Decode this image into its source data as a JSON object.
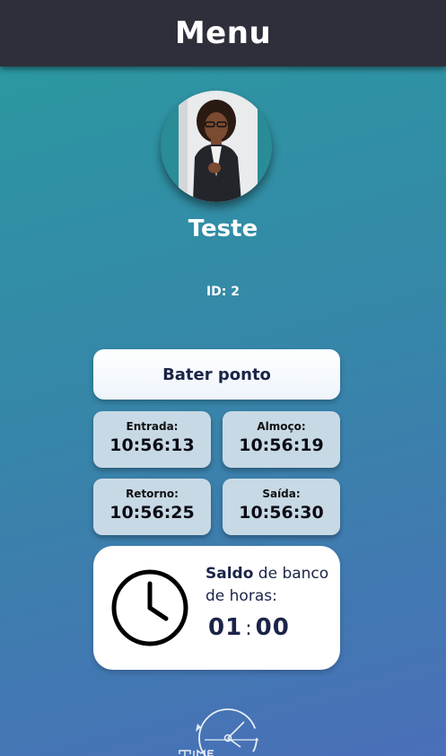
{
  "header": {
    "title": "Menu"
  },
  "profile": {
    "name": "Teste",
    "id_text": "ID: 2"
  },
  "actions": {
    "punch_label": "Bater ponto"
  },
  "records": [
    {
      "label": "Entrada:",
      "time": "10:56:13"
    },
    {
      "label": "Almoço:",
      "time": "10:56:19"
    },
    {
      "label": "Retorno:",
      "time": "10:56:25"
    },
    {
      "label": "Saída:",
      "time": "10:56:30"
    }
  ],
  "balance": {
    "title_bold": "Saldo",
    "title_rest": " de banco de horas:",
    "hours": "01",
    "minutes": "00"
  },
  "colors": {
    "header_bg": "#2e2f3a",
    "primary_text": "#1b2447",
    "card_bg": "#c8d9e6"
  },
  "icons": {
    "clock": "clock-icon",
    "logo": "app-logo"
  }
}
